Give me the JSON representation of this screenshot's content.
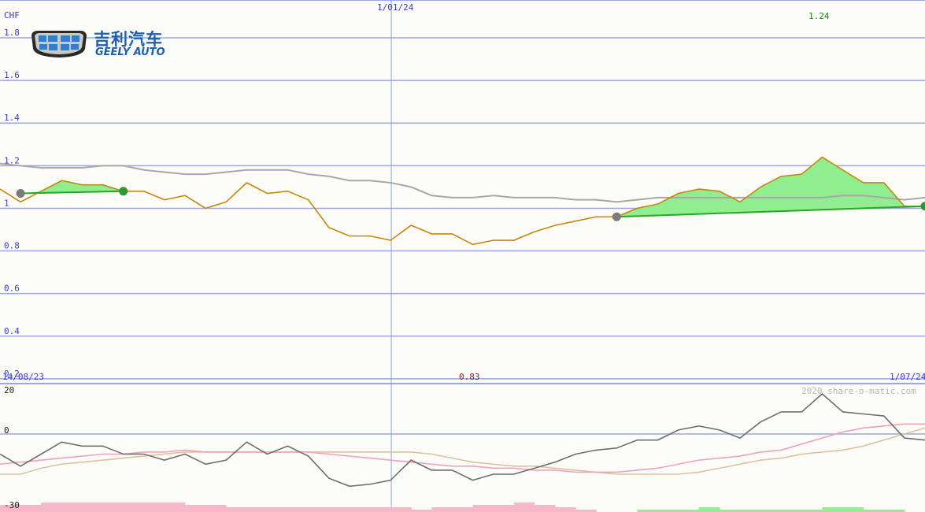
{
  "brand": {
    "name_cn": "吉利汽车",
    "name_en": "GEELY AUTO",
    "logo_icon": "geely-shield-logo"
  },
  "watermark": "2020 share-o-matic.com",
  "chart_data": [
    {
      "type": "line",
      "currency": "CHF",
      "y_ticks": [
        "1.8",
        "1.6",
        "1.4",
        "1.2",
        "1",
        "0.8",
        "0.6",
        "0.4",
        "0.2"
      ],
      "y_tick_values": [
        1.8,
        1.6,
        1.4,
        1.2,
        1.0,
        0.8,
        0.6,
        0.4,
        0.2
      ],
      "ylim": [
        0,
        1.8
      ],
      "start_label": "14/08/23",
      "mid_label": "1/01/24",
      "end_label": "1/07/24",
      "high_label": "1.24",
      "low_label": "0.83",
      "grid": true,
      "colors": {
        "price": "#c8860b",
        "average": "#a8a8a8",
        "gain_fill": "#90ee90",
        "gain_line": "#22aa22",
        "grid": "#9aa6e6",
        "tick": "#3b3bc4",
        "high": "#1a8a1a",
        "low": "#8b1a1a"
      },
      "series": [
        {
          "key": "price",
          "values": [
            1.09,
            1.03,
            1.08,
            1.13,
            1.11,
            1.11,
            1.08,
            1.08,
            1.04,
            1.06,
            1.0,
            1.03,
            1.12,
            1.07,
            1.08,
            1.04,
            0.91,
            0.87,
            0.87,
            0.85,
            0.92,
            0.88,
            0.88,
            0.83,
            0.85,
            0.85,
            0.89,
            0.92,
            0.94,
            0.96,
            0.96,
            1.0,
            1.02,
            1.07,
            1.09,
            1.08,
            1.03,
            1.1,
            1.15,
            1.16,
            1.24,
            1.18,
            1.12,
            1.12,
            1.01,
            1.01
          ]
        },
        {
          "key": "average",
          "values": [
            1.21,
            1.2,
            1.19,
            1.19,
            1.19,
            1.2,
            1.2,
            1.18,
            1.17,
            1.16,
            1.16,
            1.17,
            1.18,
            1.18,
            1.18,
            1.16,
            1.15,
            1.13,
            1.13,
            1.12,
            1.1,
            1.06,
            1.05,
            1.05,
            1.06,
            1.05,
            1.05,
            1.05,
            1.04,
            1.04,
            1.03,
            1.04,
            1.05,
            1.05,
            1.05,
            1.05,
            1.05,
            1.05,
            1.05,
            1.05,
            1.05,
            1.06,
            1.06,
            1.05,
            1.04,
            1.05
          ]
        }
      ],
      "trend_segments": [
        {
          "from_index": 1,
          "to_index": 6,
          "from_value": 1.07,
          "to_value": 1.08
        },
        {
          "from_index": 30,
          "to_index": 45,
          "from_value": 0.96,
          "to_value": 1.01
        }
      ]
    },
    {
      "type": "line",
      "y_ticks": [
        "20",
        "0",
        "-30"
      ],
      "y_tick_values": [
        20,
        0,
        -30
      ],
      "ylim": [
        -30,
        20
      ],
      "grid": true,
      "colors": {
        "momentum": "#6e6e6e",
        "signal_pink": "#f0a0c0",
        "signal_tan": "#dcc29a",
        "bar_negative": "#f6b8c8",
        "bar_positive": "#90ee90"
      },
      "series": [
        {
          "key": "momentum",
          "values": [
            -10,
            -16,
            -10,
            -4,
            -6,
            -6,
            -10,
            -10,
            -13,
            -10,
            -15,
            -13,
            -4,
            -10,
            -6,
            -11,
            -22,
            -26,
            -25,
            -23,
            -13,
            -18,
            -18,
            -23,
            -20,
            -20,
            -17,
            -14,
            -10,
            -8,
            -7,
            -3,
            -3,
            2,
            4,
            2,
            -2,
            6,
            11,
            11,
            20,
            11,
            10,
            9,
            -2,
            -3
          ]
        },
        {
          "key": "signal_pink",
          "values": [
            -15,
            -14,
            -13,
            -12,
            -11,
            -10,
            -10,
            -9,
            -9,
            -8,
            -9,
            -9,
            -9,
            -9,
            -9,
            -9,
            -10,
            -11,
            -12,
            -13,
            -14,
            -15,
            -16,
            -16,
            -17,
            -17,
            -18,
            -18,
            -19,
            -19,
            -19,
            -18,
            -17,
            -15,
            -13,
            -12,
            -11,
            -9,
            -8,
            -5,
            -2,
            1,
            3,
            4,
            5,
            5
          ]
        },
        {
          "key": "signal_tan",
          "values": [
            -20,
            -20,
            -17,
            -15,
            -14,
            -13,
            -12,
            -11,
            -10,
            -9,
            -9,
            -9,
            -9,
            -9,
            -9,
            -9,
            -9,
            -9,
            -9,
            -9,
            -9,
            -10,
            -12,
            -14,
            -15,
            -16,
            -16,
            -17,
            -18,
            -19,
            -20,
            -20,
            -20,
            -20,
            -19,
            -17,
            -15,
            -13,
            -12,
            -10,
            -9,
            -8,
            -6,
            -3,
            0,
            3
          ]
        }
      ],
      "histogram": [
        -3,
        -3,
        -4,
        -4,
        -4,
        -4,
        -4,
        -4,
        -4,
        -3,
        -3,
        -2,
        -2,
        -2,
        -2,
        -2,
        -2,
        -2,
        -2,
        -2,
        -1,
        -2,
        -2,
        -3,
        -3,
        -4,
        -3,
        -2,
        -1,
        0,
        0,
        1,
        1,
        1,
        2,
        1,
        1,
        1,
        1,
        1,
        2,
        2,
        1,
        1,
        0,
        0
      ]
    }
  ]
}
